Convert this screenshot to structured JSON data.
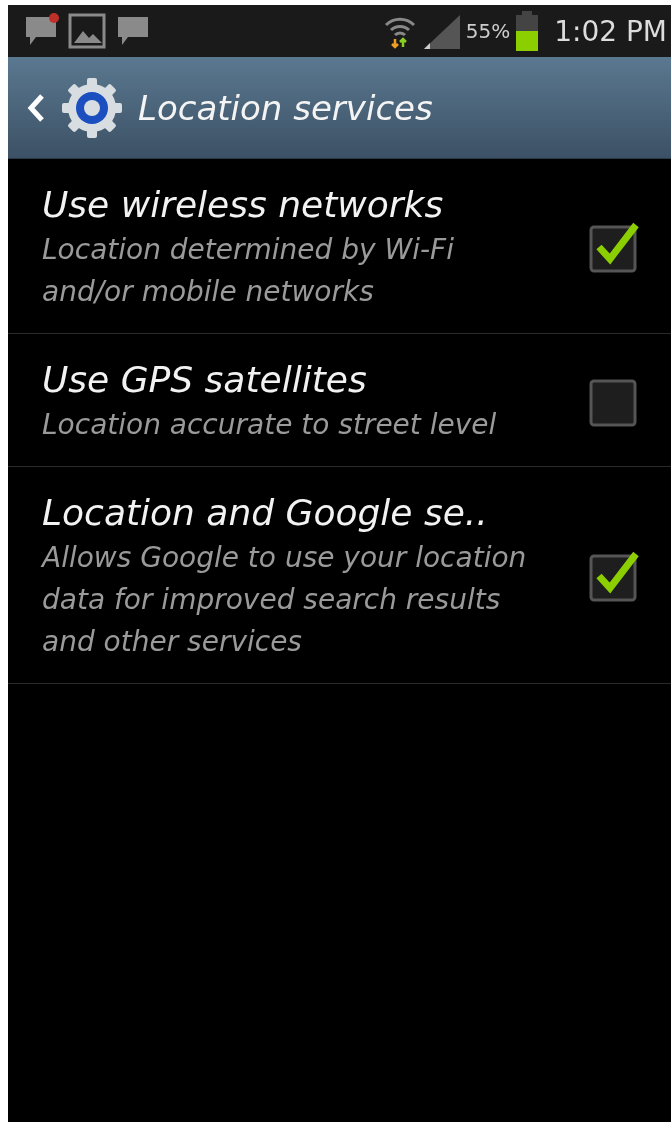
{
  "status_bar": {
    "battery_text": "55%",
    "time": "1:02 PM"
  },
  "header": {
    "title": "Location services"
  },
  "settings": [
    {
      "title": "Use wireless networks",
      "summary": "Location determined by Wi-Fi and/or mobile networks",
      "checked": true
    },
    {
      "title": "Use GPS satellites",
      "summary": "Location accurate to street level",
      "checked": false
    },
    {
      "title": "Location and Google se..",
      "summary": "Allows Google to use your location data for improved search results and other services",
      "checked": true
    }
  ]
}
